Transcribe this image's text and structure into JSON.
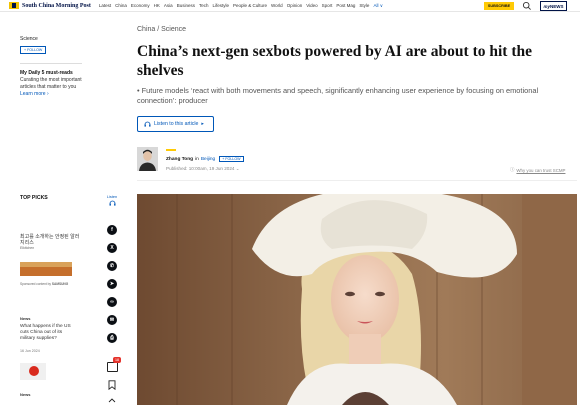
{
  "header": {
    "brand": "South China Morning Post",
    "nav": [
      "Latest",
      "China",
      "Economy",
      "HK",
      "Asia",
      "Business",
      "Tech",
      "Lifestyle",
      "People & Culture",
      "World",
      "Opinion",
      "Video",
      "Sport",
      "Post Mag",
      "Style"
    ],
    "nav_all": "All ∨",
    "subscribe": "SUBSCRIBE",
    "mynews_prefix": "my",
    "mynews_suffix": "NEWS",
    "search_icon": "search-icon"
  },
  "sidebar": {
    "section": "Science",
    "follow": "+ FOLLOW",
    "daily_title": "My Daily 5 must-reads",
    "daily_desc": "Curating the most important articles that matter to you",
    "learn_more": "Learn more",
    "learn_more_arrow": "›"
  },
  "article": {
    "breadcrumb": "China / Science",
    "headline": "China’s next-gen sexbots powered by AI are about to hit the shelves",
    "summary": "• Future models ‘react with both movements and speech, significantly enhancing user experience by focusing on emotional connection’: producer",
    "listen_label": "Listen to this article",
    "listen_arrow": "▸",
    "author_name": "Zhang Tong",
    "author_in": "in",
    "author_location": "Beijing",
    "author_follow": "+ FOLLOW",
    "published": "Published: 10:00am, 19 Jun 2024",
    "published_arrow": "⌄",
    "trust_icon": "ⓘ",
    "trust_link": "Why you can trust SCMP"
  },
  "top_picks": {
    "title": "TOP PICKS",
    "item1_title": "최고를 소개하는 안정된 알러지리스",
    "item1_sub": "Elkitchen",
    "ad_note": "Sponsored content by",
    "ad_brand": "SAMSUNG",
    "news1_label": "News",
    "news1_text": "What happens if the US cuts China out of its military supplies?",
    "news1_date": "16 Jun 2024",
    "news2_label": "News"
  },
  "rail": {
    "listen": "Listen",
    "shares": [
      {
        "name": "facebook-icon",
        "glyph": "f"
      },
      {
        "name": "x-icon",
        "glyph": "X"
      },
      {
        "name": "whatsapp-icon",
        "glyph": "✆"
      },
      {
        "name": "telegram-icon",
        "glyph": "➤"
      },
      {
        "name": "link-icon",
        "glyph": "∞"
      },
      {
        "name": "email-icon",
        "glyph": "✉"
      },
      {
        "name": "print-icon",
        "glyph": "⎙"
      }
    ],
    "comment_count": "18"
  },
  "colors": {
    "brand_navy": "#001246",
    "accent_yellow": "#ffca05",
    "link_blue": "#0057b8",
    "badge_red": "#e5322b"
  }
}
